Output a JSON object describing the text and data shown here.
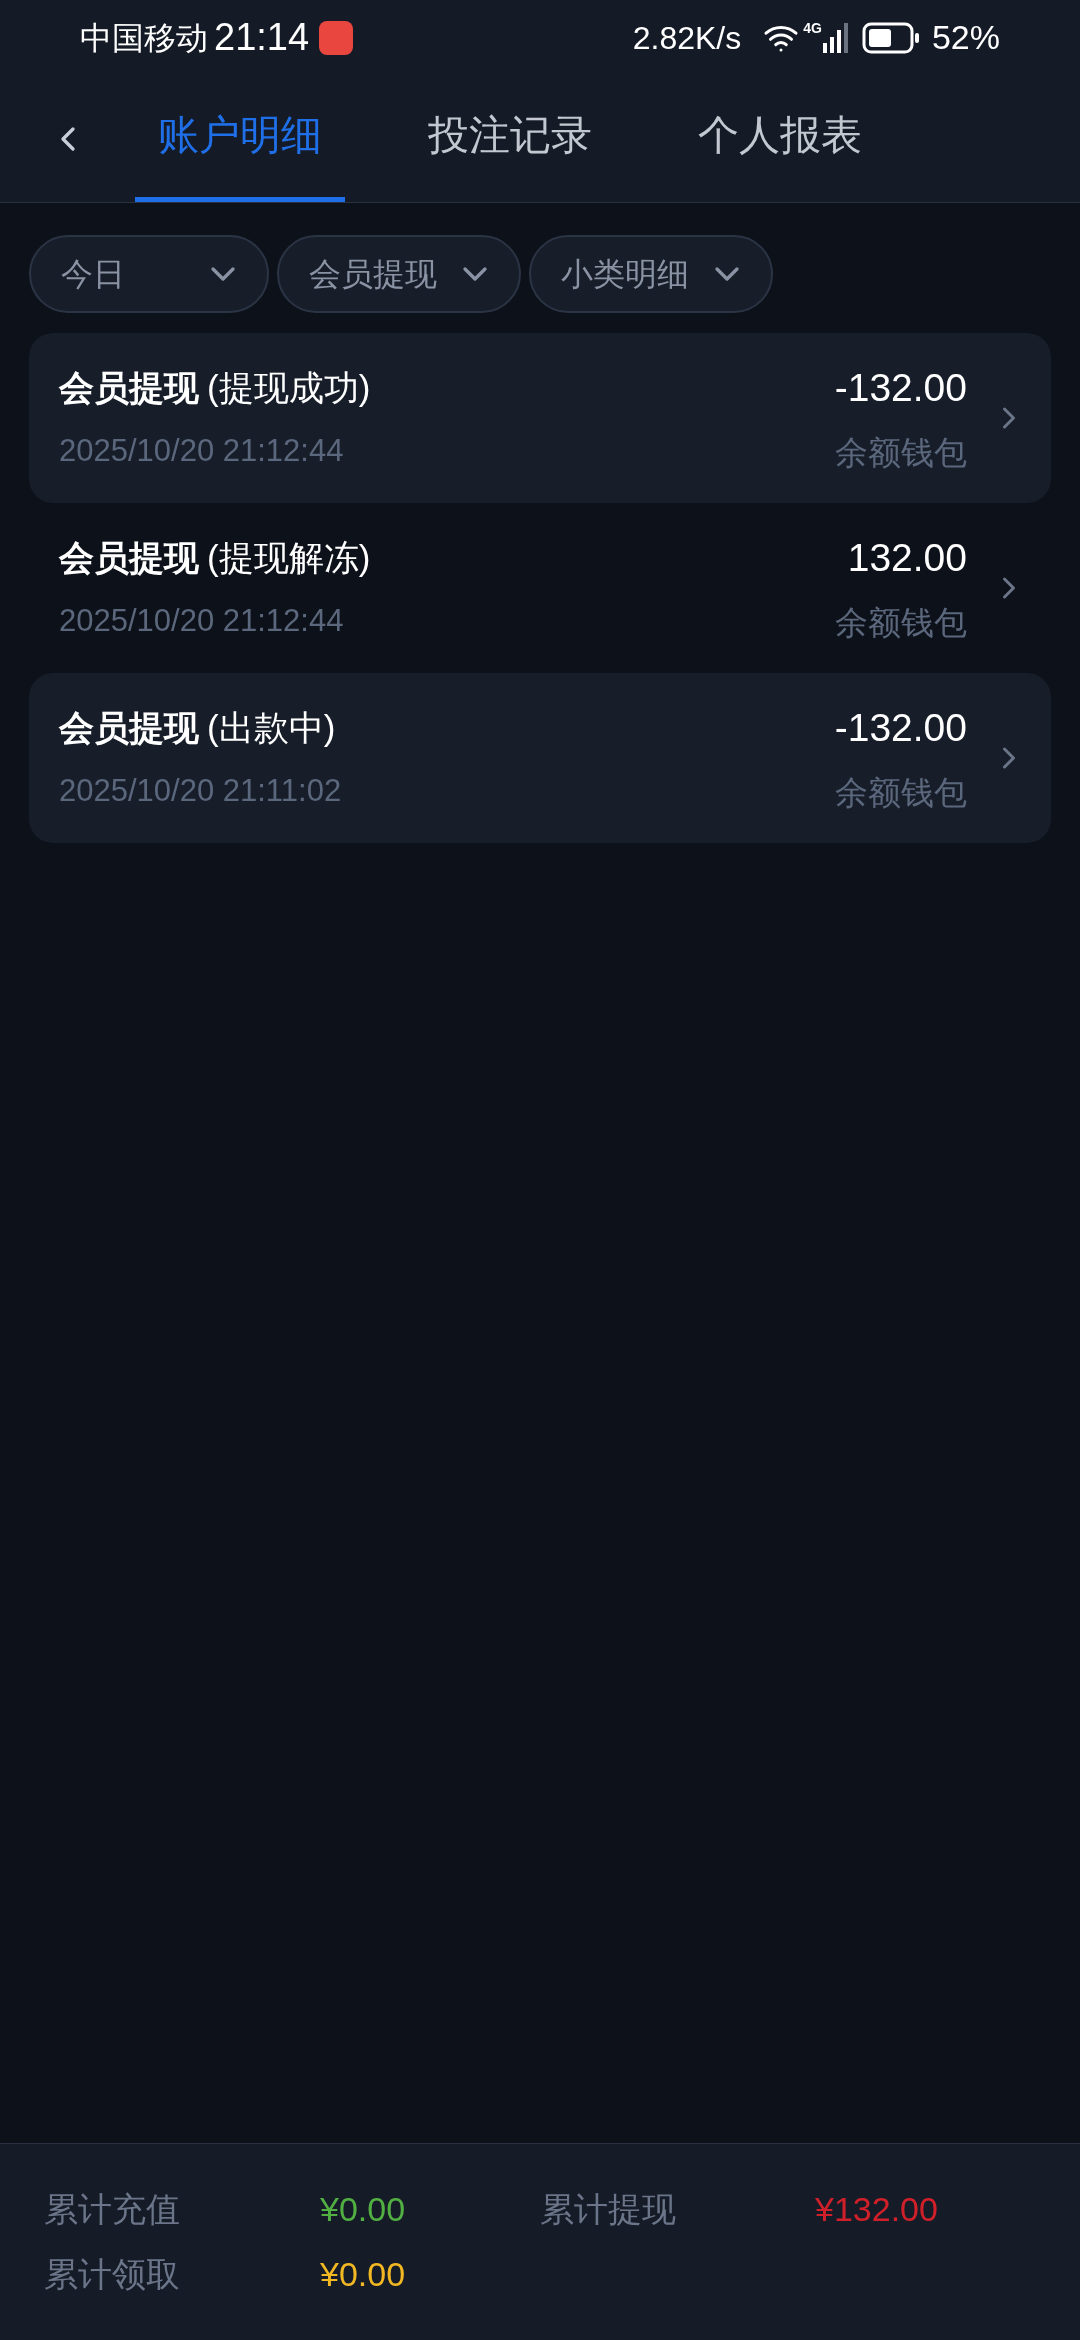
{
  "status_bar": {
    "carrier": "中国移动",
    "time": "21:14",
    "speed": "2.82K/s",
    "network": "4G",
    "battery": "52%"
  },
  "tabs": [
    {
      "label": "账户明细",
      "selected": true
    },
    {
      "label": "投注记录",
      "selected": false
    },
    {
      "label": "个人报表",
      "selected": false
    }
  ],
  "filters": [
    {
      "label": "今日"
    },
    {
      "label": "会员提现"
    },
    {
      "label": "小类明细"
    }
  ],
  "records": [
    {
      "title": "会员提现",
      "status": "(提现成功)",
      "time": "2025/10/20 21:12:44",
      "amount": "-132.00",
      "wallet": "余额钱包"
    },
    {
      "title": "会员提现",
      "status": "(提现解冻)",
      "time": "2025/10/20 21:12:44",
      "amount": "132.00",
      "wallet": "余额钱包"
    },
    {
      "title": "会员提现",
      "status": "(出款中)",
      "time": "2025/10/20 21:11:02",
      "amount": "-132.00",
      "wallet": "余额钱包"
    }
  ],
  "summary": [
    {
      "label": "累计充值",
      "value": "¥0.00",
      "color": "#52b043"
    },
    {
      "label": "累计提现",
      "value": "¥132.00",
      "color": "#d2202a"
    },
    {
      "label": "累计领取",
      "value": "¥0.00",
      "color": "#f2b824"
    }
  ]
}
